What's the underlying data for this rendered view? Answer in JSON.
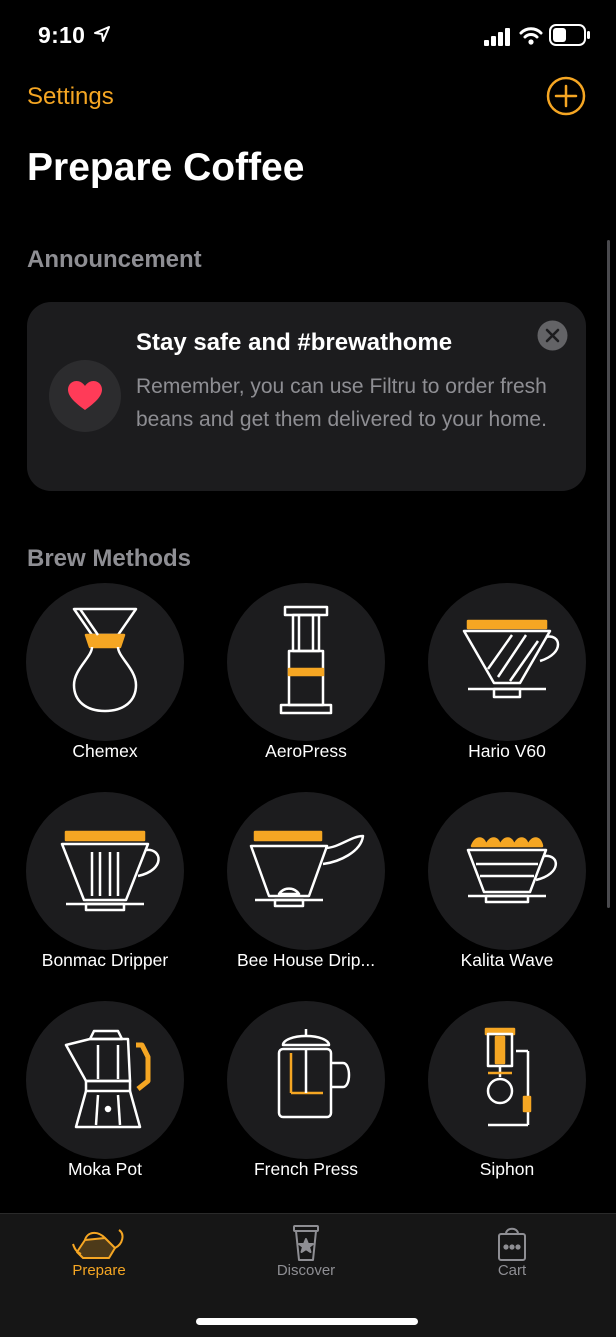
{
  "status_bar": {
    "time": "9:10"
  },
  "nav": {
    "settings_label": "Settings",
    "title": "Prepare Coffee"
  },
  "announcement": {
    "section_title": "Announcement",
    "title": "Stay safe and #brewathome",
    "body": "Remember, you can use Filtru to order fresh beans and get them delivered to your home."
  },
  "brew_methods": {
    "section_title": "Brew Methods",
    "items": [
      {
        "label": "Chemex",
        "icon": "chemex-icon"
      },
      {
        "label": "AeroPress",
        "icon": "aeropress-icon"
      },
      {
        "label": "Hario V60",
        "icon": "hario-v60-icon"
      },
      {
        "label": "Bonmac Dripper",
        "icon": "bonmac-dripper-icon"
      },
      {
        "label": "Bee House Drip...",
        "icon": "bee-house-dripper-icon"
      },
      {
        "label": "Kalita Wave",
        "icon": "kalita-wave-icon"
      },
      {
        "label": "Moka Pot",
        "icon": "moka-pot-icon"
      },
      {
        "label": "French Press",
        "icon": "french-press-icon"
      },
      {
        "label": "Siphon",
        "icon": "siphon-icon"
      }
    ]
  },
  "tab_bar": {
    "active": "Prepare",
    "tabs": [
      {
        "label": "Prepare",
        "icon": "kettle-icon"
      },
      {
        "label": "Discover",
        "icon": "cup-star-icon"
      },
      {
        "label": "Cart",
        "icon": "shopping-bag-icon"
      }
    ]
  },
  "colors": {
    "accent": "#f5a623",
    "background": "#000000",
    "card": "#1c1c1e",
    "secondary_text": "#8e8e93",
    "heart": "#ff3b58"
  }
}
